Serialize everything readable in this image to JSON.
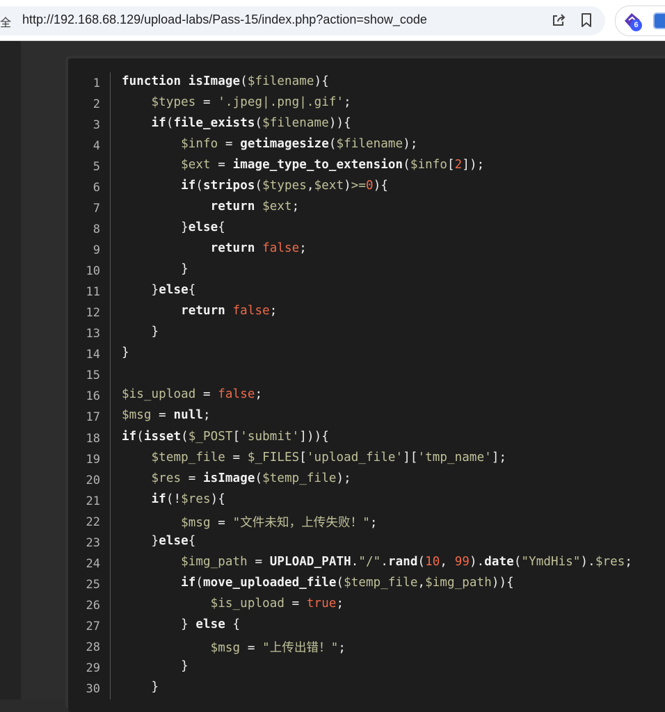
{
  "browser": {
    "security_text": "全",
    "url": "http://192.168.68.129/upload-labs/Pass-15/index.php?action=show_code",
    "extension_badge": "6",
    "icons": [
      "share-icon",
      "bookmark-icon",
      "extension-icon",
      "extension-app-icon"
    ]
  },
  "code": {
    "colors": {
      "keyword": "#f2f2f2",
      "variable": "#c1c29a",
      "string": "#c1c29a",
      "literal": "#f06a4a",
      "background": "#1d1d1d"
    },
    "lines": [
      {
        "n": "1",
        "tokens": [
          [
            "k",
            "function "
          ],
          [
            "k",
            "isImage"
          ],
          [
            "p",
            "("
          ],
          [
            "v",
            "$filename"
          ],
          [
            "p",
            "){"
          ]
        ]
      },
      {
        "n": "2",
        "tokens": [
          [
            "p",
            "    "
          ],
          [
            "v",
            "$types"
          ],
          [
            "p",
            " = "
          ],
          [
            "s",
            "'.jpeg|.png|.gif'"
          ],
          [
            "p",
            ";"
          ]
        ]
      },
      {
        "n": "3",
        "tokens": [
          [
            "p",
            "    "
          ],
          [
            "k",
            "if"
          ],
          [
            "p",
            "("
          ],
          [
            "k",
            "file_exists"
          ],
          [
            "p",
            "("
          ],
          [
            "v",
            "$filename"
          ],
          [
            "p",
            "))"
          ],
          [
            "p",
            "{"
          ]
        ]
      },
      {
        "n": "4",
        "tokens": [
          [
            "p",
            "        "
          ],
          [
            "v",
            "$info"
          ],
          [
            "p",
            " = "
          ],
          [
            "k",
            "getimagesize"
          ],
          [
            "p",
            "("
          ],
          [
            "v",
            "$filename"
          ],
          [
            "p",
            ");"
          ]
        ]
      },
      {
        "n": "5",
        "tokens": [
          [
            "p",
            "        "
          ],
          [
            "v",
            "$ext"
          ],
          [
            "p",
            " = "
          ],
          [
            "k",
            "image_type_to_extension"
          ],
          [
            "p",
            "("
          ],
          [
            "v",
            "$info"
          ],
          [
            "p",
            "["
          ],
          [
            "n",
            "2"
          ],
          [
            "p",
            "]);"
          ]
        ]
      },
      {
        "n": "6",
        "tokens": [
          [
            "p",
            "        "
          ],
          [
            "k",
            "if"
          ],
          [
            "p",
            "("
          ],
          [
            "k",
            "stripos"
          ],
          [
            "p",
            "("
          ],
          [
            "v",
            "$types"
          ],
          [
            "p",
            ","
          ],
          [
            "v",
            "$ext"
          ],
          [
            "p",
            ")"
          ],
          [
            "v",
            ">="
          ],
          [
            "n",
            "0"
          ],
          [
            "p",
            "){"
          ]
        ]
      },
      {
        "n": "7",
        "tokens": [
          [
            "p",
            "            "
          ],
          [
            "k",
            "return "
          ],
          [
            "v",
            "$ext"
          ],
          [
            "p",
            ";"
          ]
        ]
      },
      {
        "n": "8",
        "tokens": [
          [
            "p",
            "        }"
          ],
          [
            "k",
            "else"
          ],
          [
            "p",
            "{"
          ]
        ]
      },
      {
        "n": "9",
        "tokens": [
          [
            "p",
            "            "
          ],
          [
            "k",
            "return "
          ],
          [
            "n",
            "false"
          ],
          [
            "p",
            ";"
          ]
        ]
      },
      {
        "n": "10",
        "tokens": [
          [
            "p",
            "        }"
          ]
        ]
      },
      {
        "n": "11",
        "tokens": [
          [
            "p",
            "    }"
          ],
          [
            "k",
            "else"
          ],
          [
            "p",
            "{"
          ]
        ]
      },
      {
        "n": "12",
        "tokens": [
          [
            "p",
            "        "
          ],
          [
            "k",
            "return "
          ],
          [
            "n",
            "false"
          ],
          [
            "p",
            ";"
          ]
        ]
      },
      {
        "n": "13",
        "tokens": [
          [
            "p",
            "    }"
          ]
        ]
      },
      {
        "n": "14",
        "tokens": [
          [
            "p",
            "}"
          ]
        ]
      },
      {
        "n": "15",
        "tokens": []
      },
      {
        "n": "16",
        "tokens": [
          [
            "v",
            "$is_upload"
          ],
          [
            "p",
            " = "
          ],
          [
            "n",
            "false"
          ],
          [
            "p",
            ";"
          ]
        ]
      },
      {
        "n": "17",
        "tokens": [
          [
            "v",
            "$msg"
          ],
          [
            "p",
            " = "
          ],
          [
            "k",
            "null"
          ],
          [
            "p",
            ";"
          ]
        ]
      },
      {
        "n": "18",
        "tokens": [
          [
            "k",
            "if"
          ],
          [
            "p",
            "("
          ],
          [
            "k",
            "isset"
          ],
          [
            "p",
            "("
          ],
          [
            "v",
            "$_POST"
          ],
          [
            "p",
            "["
          ],
          [
            "s",
            "'submit'"
          ],
          [
            "p",
            "])){"
          ]
        ]
      },
      {
        "n": "19",
        "tokens": [
          [
            "p",
            "    "
          ],
          [
            "v",
            "$temp_file"
          ],
          [
            "p",
            " = "
          ],
          [
            "v",
            "$_FILES"
          ],
          [
            "p",
            "["
          ],
          [
            "s",
            "'upload_file'"
          ],
          [
            "p",
            "]["
          ],
          [
            "s",
            "'tmp_name'"
          ],
          [
            "p",
            "];"
          ]
        ]
      },
      {
        "n": "20",
        "tokens": [
          [
            "p",
            "    "
          ],
          [
            "v",
            "$res"
          ],
          [
            "p",
            " = "
          ],
          [
            "k",
            "isImage"
          ],
          [
            "p",
            "("
          ],
          [
            "v",
            "$temp_file"
          ],
          [
            "p",
            ");"
          ]
        ]
      },
      {
        "n": "21",
        "tokens": [
          [
            "p",
            "    "
          ],
          [
            "k",
            "if"
          ],
          [
            "p",
            "(!"
          ],
          [
            "v",
            "$res"
          ],
          [
            "p",
            "){"
          ]
        ]
      },
      {
        "n": "22",
        "tokens": [
          [
            "p",
            "        "
          ],
          [
            "v",
            "$msg"
          ],
          [
            "p",
            " = "
          ],
          [
            "s",
            "\"文件未知，上传失败！\""
          ],
          [
            "p",
            ";"
          ]
        ]
      },
      {
        "n": "23",
        "tokens": [
          [
            "p",
            "    }"
          ],
          [
            "k",
            "else"
          ],
          [
            "p",
            "{"
          ]
        ]
      },
      {
        "n": "24",
        "tokens": [
          [
            "p",
            "        "
          ],
          [
            "v",
            "$img_path"
          ],
          [
            "p",
            " = "
          ],
          [
            "k",
            "UPLOAD_PATH"
          ],
          [
            "p",
            "."
          ],
          [
            "s",
            "\"/\""
          ],
          [
            "p",
            "."
          ],
          [
            "k",
            "rand"
          ],
          [
            "p",
            "("
          ],
          [
            "n",
            "10"
          ],
          [
            "p",
            ", "
          ],
          [
            "n",
            "99"
          ],
          [
            "p",
            ")."
          ],
          [
            "k",
            "date"
          ],
          [
            "p",
            "("
          ],
          [
            "s",
            "\"YmdHis\""
          ],
          [
            "p",
            ")."
          ],
          [
            "v",
            "$res"
          ],
          [
            "p",
            ";"
          ]
        ]
      },
      {
        "n": "25",
        "tokens": [
          [
            "p",
            "        "
          ],
          [
            "k",
            "if"
          ],
          [
            "p",
            "("
          ],
          [
            "k",
            "move_uploaded_file"
          ],
          [
            "p",
            "("
          ],
          [
            "v",
            "$temp_file"
          ],
          [
            "p",
            ","
          ],
          [
            "v",
            "$img_path"
          ],
          [
            "p",
            "))"
          ],
          [
            "p",
            "{"
          ]
        ]
      },
      {
        "n": "26",
        "tokens": [
          [
            "p",
            "            "
          ],
          [
            "v",
            "$is_upload"
          ],
          [
            "p",
            " = "
          ],
          [
            "n",
            "true"
          ],
          [
            "p",
            ";"
          ]
        ]
      },
      {
        "n": "27",
        "tokens": [
          [
            "p",
            "        } "
          ],
          [
            "k",
            "else"
          ],
          [
            "p",
            " {"
          ]
        ]
      },
      {
        "n": "28",
        "tokens": [
          [
            "p",
            "            "
          ],
          [
            "v",
            "$msg"
          ],
          [
            "p",
            " = "
          ],
          [
            "s",
            "\"上传出错！\""
          ],
          [
            "p",
            ";"
          ]
        ]
      },
      {
        "n": "29",
        "tokens": [
          [
            "p",
            "        }"
          ]
        ]
      },
      {
        "n": "30",
        "tokens": [
          [
            "p",
            "    }"
          ]
        ]
      }
    ]
  }
}
